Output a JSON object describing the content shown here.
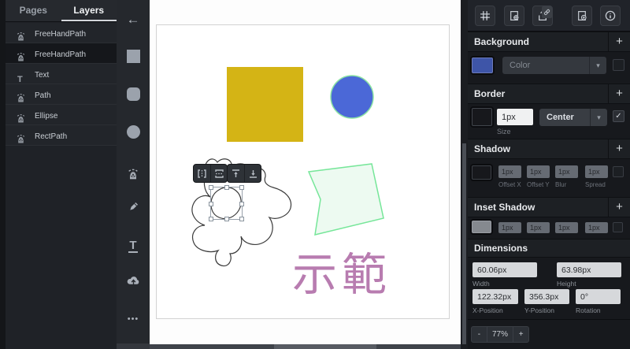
{
  "glyphs": {
    "back_arrow": "←",
    "chevron": "▾",
    "check": "✓",
    "ellipsis": "•••",
    "text_tool": "T",
    "text_layer_icon": "T"
  },
  "left_panel": {
    "tabs": [
      {
        "label": "Pages"
      },
      {
        "label": "Layers"
      }
    ],
    "layers": [
      {
        "icon": "path-icon",
        "label": "FreeHandPath"
      },
      {
        "icon": "path-icon",
        "label": "FreeHandPath"
      },
      {
        "icon": "text-icon",
        "label": "Text"
      },
      {
        "icon": "path-icon",
        "label": "Path"
      },
      {
        "icon": "path-icon",
        "label": "Ellipse"
      },
      {
        "icon": "path-icon",
        "label": "RectPath"
      }
    ]
  },
  "canvas": {
    "shapes": {
      "square": {
        "fill": "#d4b415"
      },
      "circle": {
        "fill": "#4b68d7",
        "stroke": "#8ce3a4"
      },
      "polygon": {
        "fill": "#edfaf1",
        "stroke": "#76e699"
      },
      "freehand": {
        "stroke": "#3b3b3b"
      },
      "text": {
        "value": "示範",
        "color": "#b87cb0"
      }
    },
    "floating_toolbar": {
      "buttons": [
        "flip-horizontal-icon",
        "flip-vertical-icon",
        "align-top-icon",
        "align-bottom-icon"
      ]
    }
  },
  "right_panel": {
    "top_toolbar": {
      "buttons": [
        "grid-icon",
        "page-settings-icon",
        "export-icon",
        "add-page-icon",
        "info-icon"
      ]
    },
    "background": {
      "title": "Background",
      "add_label": "+",
      "swatch_color": "#3e55a8",
      "color_placeholder": "Color"
    },
    "border": {
      "title": "Border",
      "add_label": "+",
      "swatch_color": "#17181c",
      "size_value": "1px",
      "size_label": "Size",
      "position_value": "Center",
      "enabled": true
    },
    "shadow": {
      "title": "Shadow",
      "add_label": "+",
      "swatch_color": "#17181c",
      "fields": [
        {
          "value": "1px",
          "label": "Offset X"
        },
        {
          "value": "1px",
          "label": "Offset Y"
        },
        {
          "value": "1px",
          "label": "Blur"
        },
        {
          "value": "1px",
          "label": "Spread"
        }
      ]
    },
    "inset_shadow": {
      "title": "Inset Shadow",
      "add_label": "+",
      "swatch_color": "#85898f",
      "fields": [
        {
          "value": "1px"
        },
        {
          "value": "1px"
        },
        {
          "value": "1px"
        },
        {
          "value": "1px"
        }
      ]
    },
    "dimensions": {
      "title": "Dimensions",
      "width": {
        "value": "60.06px",
        "label": "Width"
      },
      "height": {
        "value": "63.98px",
        "label": "Height"
      },
      "x": {
        "value": "122.32px",
        "label": "X-Position"
      },
      "y": {
        "value": "356.3px",
        "label": "Y-Position"
      },
      "rotation": {
        "value": "0°",
        "label": "Rotation"
      }
    },
    "zoom": {
      "minus": "-",
      "level": "77%",
      "plus": "+"
    }
  }
}
